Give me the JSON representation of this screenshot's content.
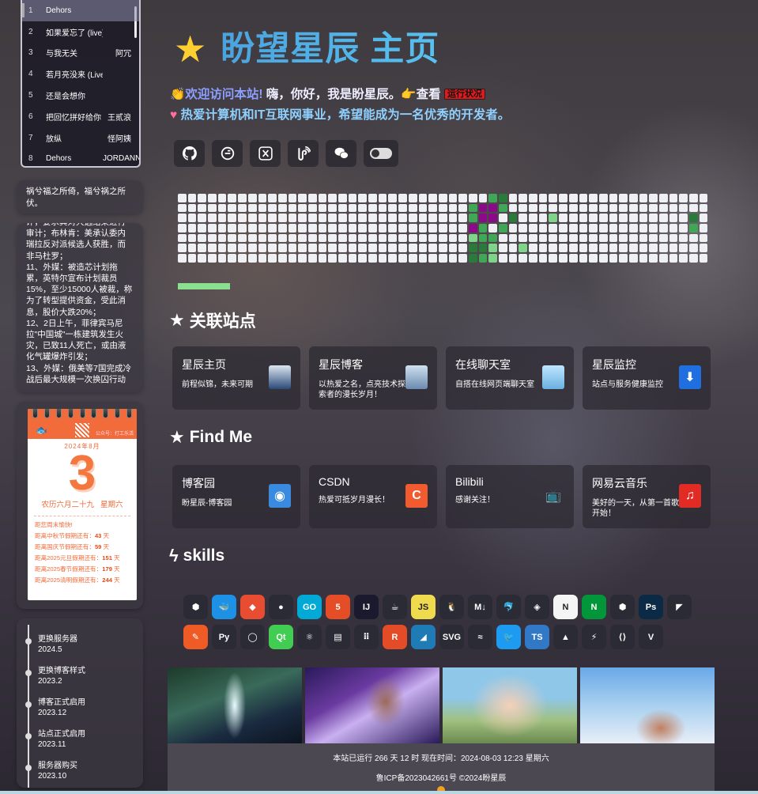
{
  "playlist": {
    "items": [
      {
        "num": "1",
        "title": "Dehors",
        "artist": "",
        "active": true
      },
      {
        "num": "2",
        "title": "如果爱忘了 (live)",
        "artist": ""
      },
      {
        "num": "3",
        "title": "与我无关",
        "artist": "阿冗"
      },
      {
        "num": "4",
        "title": "若月亮没来 (Live版)",
        "artist": ""
      },
      {
        "num": "5",
        "title": "还是会想你",
        "artist": ""
      },
      {
        "num": "6",
        "title": "把回忆拼好给你",
        "artist": "王贰浪"
      },
      {
        "num": "7",
        "title": "放纵",
        "artist": "怪阿姨"
      },
      {
        "num": "8",
        "title": "Dehors",
        "artist": "JORDANN"
      }
    ]
  },
  "quote": "祸兮福之所倚，福兮祸之所伏。",
  "news": "评，要求其对大选结果进行审计；布林肯：美承认委内瑞拉反对派候选人获胜，而非马杜罗；\n11、外媒：被造芯计划拖累，英特尔宣布计划裁员15%，至少15000人被裁，称为了转型提供资金，受此消息，股价大跌20%；\n12、2日上午，菲律宾马尼拉\"中国城\"一栋建筑发生火灾，已致11人死亡，或由液化气罐爆炸引发；\n13、外媒：俄美等7国完成冷战后最大规模一次换囚行动",
  "calendar": {
    "month": "2024年8月",
    "day": "3",
    "lunar": "农历六月二十九",
    "weekday": "星期六",
    "small": "公众号：打工乐活",
    "reminder_title": "距您周末愉快!",
    "lines": [
      {
        "label": "距离中秋节假期还有：",
        "value": "43",
        "unit": "天"
      },
      {
        "label": "距离国庆节假期还有：",
        "value": "59",
        "unit": "天"
      },
      {
        "label": "距离2025元旦假期还有：",
        "value": "151",
        "unit": "天"
      },
      {
        "label": "距离2025春节假期还有：",
        "value": "179",
        "unit": "天"
      },
      {
        "label": "距离2025清明假期还有：",
        "value": "244",
        "unit": "天"
      }
    ]
  },
  "timeline": [
    {
      "title": "更换服务器",
      "date": "2024.5"
    },
    {
      "title": "更换博客样式",
      "date": "2023.2"
    },
    {
      "title": "博客正式启用",
      "date": "2023.12"
    },
    {
      "title": "站点正式启用",
      "date": "2023.11"
    },
    {
      "title": "服务器购买",
      "date": "2023.10"
    }
  ],
  "hero": {
    "title": "盼望星辰 主页",
    "welcome": "欢迎访问本站!",
    "greeting": "嗨，你好，我是盼星辰。",
    "check": "查看",
    "status": "运行状况",
    "motto": "热爱计算机和IT互联网事业，希望能成为一名优秀的开发者。"
  },
  "sections": {
    "linked": "关联站点",
    "find": "Find Me",
    "skills": "skills"
  },
  "linked_sites": [
    {
      "title": "星辰主页",
      "desc": "前程似锦，未来可期"
    },
    {
      "title": "星辰博客",
      "desc": "以热爱之名，点亮技术探索者的漫长岁月！"
    },
    {
      "title": "在线聊天室",
      "desc": "自搭在线网页端聊天室"
    },
    {
      "title": "星辰监控",
      "desc": "站点与服务健康监控"
    }
  ],
  "find_me": [
    {
      "title": "博客园",
      "desc": "盼星辰-博客园"
    },
    {
      "title": "CSDN",
      "desc": "热爱可抵岁月漫长！"
    },
    {
      "title": "Bilibili",
      "desc": "感谢关注！"
    },
    {
      "title": "网易云音乐",
      "desc": "美好的一天，从第一首歌开始！"
    }
  ],
  "skills_row1": [
    "bootstrap",
    "docker",
    "git",
    "github",
    "go",
    "html5",
    "intellij",
    "java",
    "js",
    "linux",
    "markdown",
    "mysql",
    "netlify",
    "nextjs",
    "nginx",
    "nodejs",
    "photoshop",
    "prisma"
  ],
  "skills_row2": [
    "postman",
    "python",
    "pytorch",
    "qt",
    "react",
    "redis",
    "rocketmq",
    "rust",
    "sqlite",
    "svg",
    "tailwind",
    "twitter",
    "ts",
    "vercel",
    "vite",
    "vscode",
    "vue"
  ],
  "footer": {
    "runtime": "本站已运行 266 天 12 时 现在时间：2024-08-03 12:23 星期六",
    "icp": "鲁ICP备2023042661号 ©2024盼星辰"
  }
}
